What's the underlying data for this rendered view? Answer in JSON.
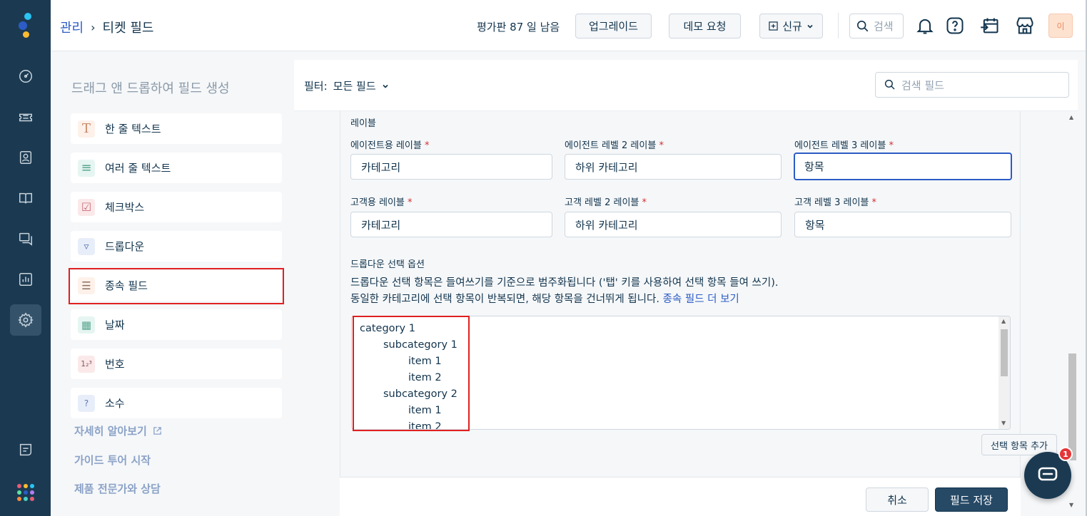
{
  "breadcrumb": {
    "parent": "관리",
    "separator": "›",
    "current": "티켓 필드"
  },
  "header": {
    "trial_text": "평가판 87 일 남음",
    "upgrade_label": "업그레이드",
    "demo_label": "데모 요청",
    "new_label": "신규",
    "search_label": "검색",
    "avatar_text": "이"
  },
  "left_panel": {
    "title": "드래그 앤 드롭하여 필드 생성",
    "items": [
      {
        "label": "한 줄 텍스트",
        "icon": "T"
      },
      {
        "label": "여러 줄 텍스트",
        "icon": "≡"
      },
      {
        "label": "체크박스",
        "icon": "☑"
      },
      {
        "label": "드롭다운",
        "icon": "▿"
      },
      {
        "label": "종속 필드",
        "icon": "☰"
      },
      {
        "label": "날짜",
        "icon": "▦"
      },
      {
        "label": "번호",
        "icon": "1₂³"
      },
      {
        "label": "소수",
        "icon": "?"
      }
    ],
    "links": [
      "자세히 알아보기",
      "가이드 투어 시작",
      "제품 전문가와 상담"
    ]
  },
  "filterbar": {
    "label": "필터:",
    "value": "모든 필드",
    "search_placeholder": "검색 필드"
  },
  "form": {
    "section_labels": "레이블",
    "agent_labels": [
      {
        "label": "에이전트용 레이블",
        "value": "카테고리"
      },
      {
        "label": "에이전트 레벨 2 레이블",
        "value": "하위 카테고리"
      },
      {
        "label": "에이전트 레벨 3 레이블",
        "value": "항목"
      }
    ],
    "customer_labels": [
      {
        "label": "고객용 레이블",
        "value": "카테고리"
      },
      {
        "label": "고객 레벨 2 레이블",
        "value": "하위 카테고리"
      },
      {
        "label": "고객 레벨 3 레이블",
        "value": "항목"
      }
    ],
    "required_mark": "*",
    "dropdown_section": "드롭다운 선택 옵션",
    "desc_line1": "드롭다운 선택 항목은 들여쓰기를 기준으로 범주화됩니다 ('탭' 키를 사용하여 선택 항목 들여 쓰기).",
    "desc_line2": "동일한 카테고리에 선택 항목이 반복되면, 해당 항목을 건너뛰게 됩니다.",
    "desc_link": "종속 필드 더 보기",
    "choices": [
      {
        "text": "category 1",
        "level": 0
      },
      {
        "text": "subcategory 1",
        "level": 1
      },
      {
        "text": "item 1",
        "level": 2
      },
      {
        "text": "item 2",
        "level": 2
      },
      {
        "text": "subcategory 2",
        "level": 1
      },
      {
        "text": "item 1",
        "level": 2
      },
      {
        "text": "item 2",
        "level": 2
      }
    ],
    "add_choice_label": "선택 항목 추가",
    "cancel_label": "취소",
    "save_label": "필드 저장"
  },
  "chat": {
    "badge": "1"
  },
  "colors": {
    "nav_bg": "#1b3a52",
    "accent": "#2c5cc5",
    "highlight": "#e02020",
    "primary_button": "#264966"
  }
}
